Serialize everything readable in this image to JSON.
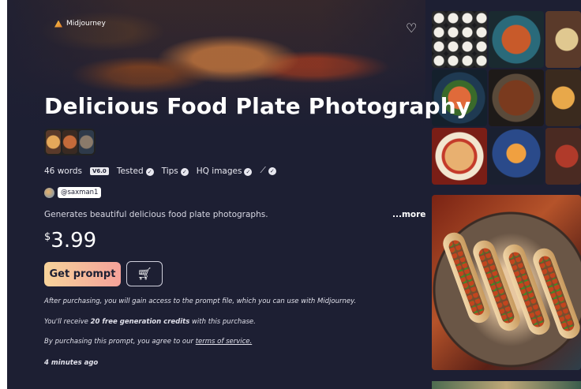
{
  "brand": {
    "name": "Midjourney"
  },
  "title": "Delicious Food Plate Photography",
  "meta": {
    "words": "46 words",
    "version": "V6.0",
    "tested": "Tested",
    "tips": "Tips",
    "hq": "HQ images"
  },
  "author": {
    "handle": "@saxman1"
  },
  "description": "Generates beautiful delicious food plate photographs.",
  "more": "...more",
  "price": {
    "currency": "$",
    "amount": "3.99"
  },
  "buttons": {
    "get_prompt": "Get prompt"
  },
  "notes": {
    "access": "After purchasing, you will gain access to the prompt file, which you can use with Midjourney.",
    "credits_pre": "You'll receive ",
    "credits_bold": "20 free generation credits",
    "credits_post": " with this purchase.",
    "tos_pre": "By purchasing this prompt, you agree to our ",
    "tos_link": "terms of service.",
    "time": "4 minutes ago"
  },
  "icons": [
    "midjourney-logo-icon",
    "heart-icon",
    "check-badge-icon",
    "brush-icon",
    "cart-icon"
  ]
}
